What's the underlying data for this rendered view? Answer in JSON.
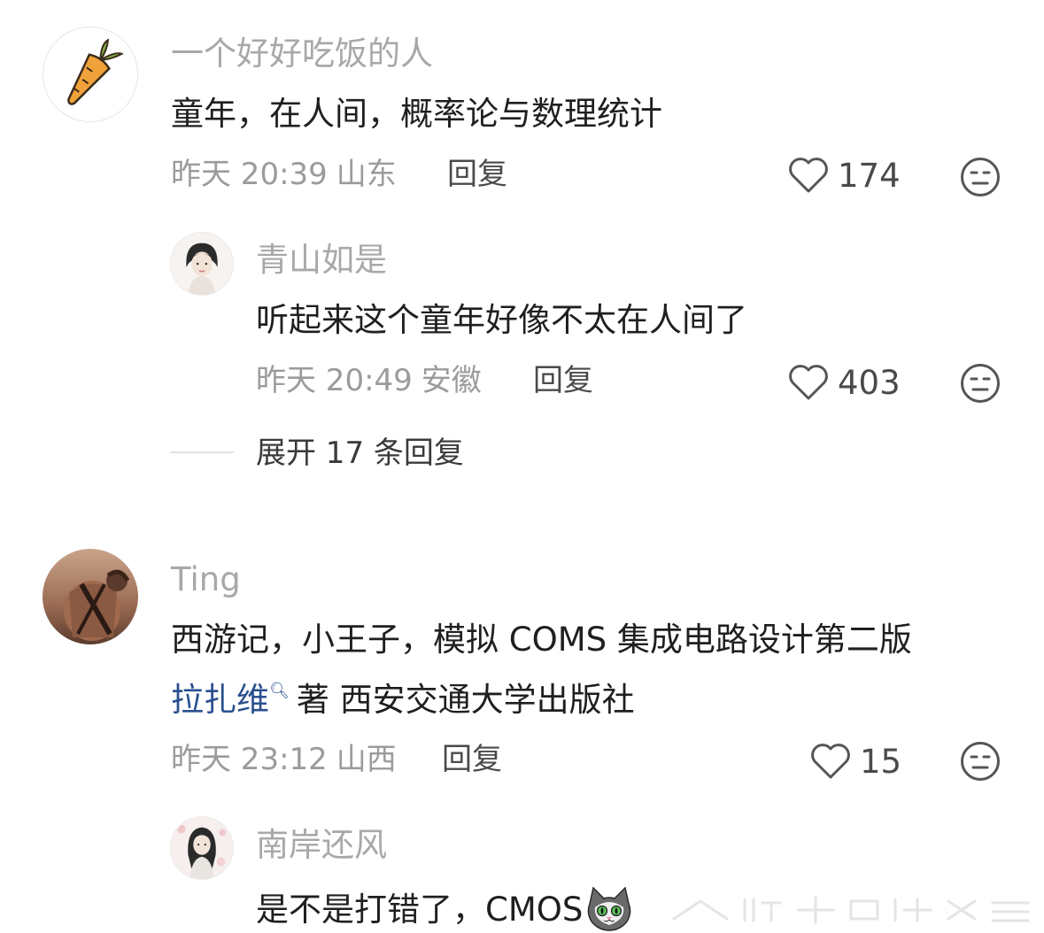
{
  "comments": [
    {
      "username": "一个好好吃饭的人",
      "text": "童年，在人间，概率论与数理统计",
      "time": "昨天 20:39",
      "location": "山东",
      "reply_label": "回复",
      "likes": "174",
      "avatar_icon": "carrot-icon",
      "replies": [
        {
          "username": "青山如是",
          "text": "听起来这个童年好像不太在人间了",
          "time": "昨天 20:49",
          "location": "安徽",
          "reply_label": "回复",
          "likes": "403"
        }
      ],
      "expand_label": "展开 17 条回复"
    },
    {
      "username": "Ting",
      "text_line1": "西游记，小王子，模拟 COMS 集成电路设计第二版",
      "text_link": "拉扎维",
      "text_line2_rest": "著 西安交通大学出版社",
      "time": "昨天 23:12",
      "location": "山西",
      "reply_label": "回复",
      "likes": "15",
      "replies": [
        {
          "username": "南岸还风",
          "text": "是不是打错了，CMOS"
        }
      ]
    }
  ],
  "colors": {
    "username": "#a8a8a8",
    "body_text": "#1f1f1f",
    "meta": "#9b9b9b",
    "link": "#2a4f8f"
  }
}
